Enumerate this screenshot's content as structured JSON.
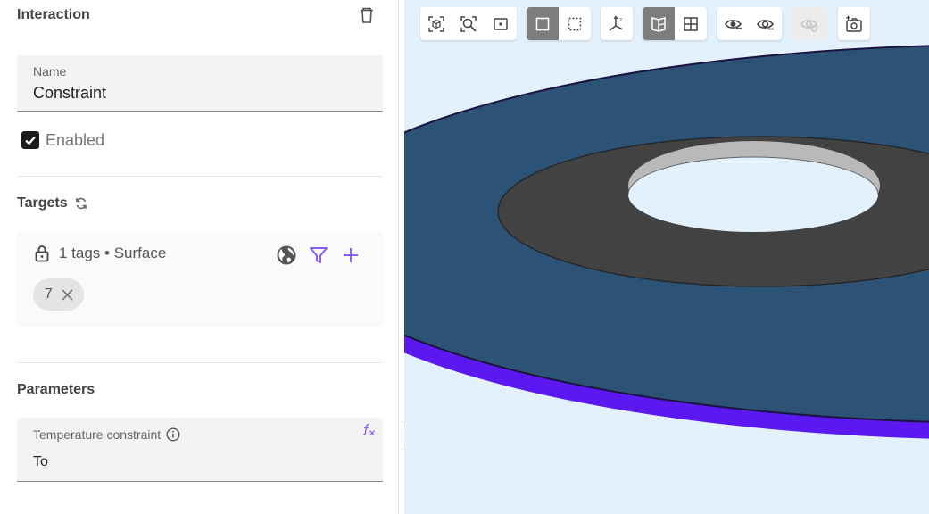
{
  "panel": {
    "interaction_title": "Interaction",
    "name_field": {
      "label": "Name",
      "value": "Constraint"
    },
    "enabled": {
      "label": "Enabled",
      "checked": true
    },
    "targets": {
      "title": "Targets",
      "summary": "1 tags • Surface",
      "chips": [
        "7"
      ]
    },
    "parameters": {
      "title": "Parameters",
      "temperature": {
        "label": "Temperature constraint",
        "value": "To"
      }
    }
  },
  "colors": {
    "accent": "#8b5cf6",
    "surface_blue": "#2c5276",
    "surface_dark": "#444444",
    "edge_purple": "#5b18f0",
    "viewport_bg": "#e3f1fc"
  },
  "toolbar": {
    "groups": [
      [
        "zoom-fit-icon",
        "zoom-selection-icon",
        "zoom-box-icon"
      ],
      [
        "select-single-icon",
        "select-box-icon"
      ],
      [
        "axes-icon"
      ],
      [
        "section-view-icon",
        "grid-view-icon"
      ],
      [
        "hide-icon",
        "show-icon"
      ],
      [
        "show-all-icon"
      ],
      [
        "screenshot-icon"
      ]
    ],
    "active": [
      "select-single-icon",
      "section-view-icon"
    ],
    "disabled": [
      "show-all-icon"
    ]
  }
}
